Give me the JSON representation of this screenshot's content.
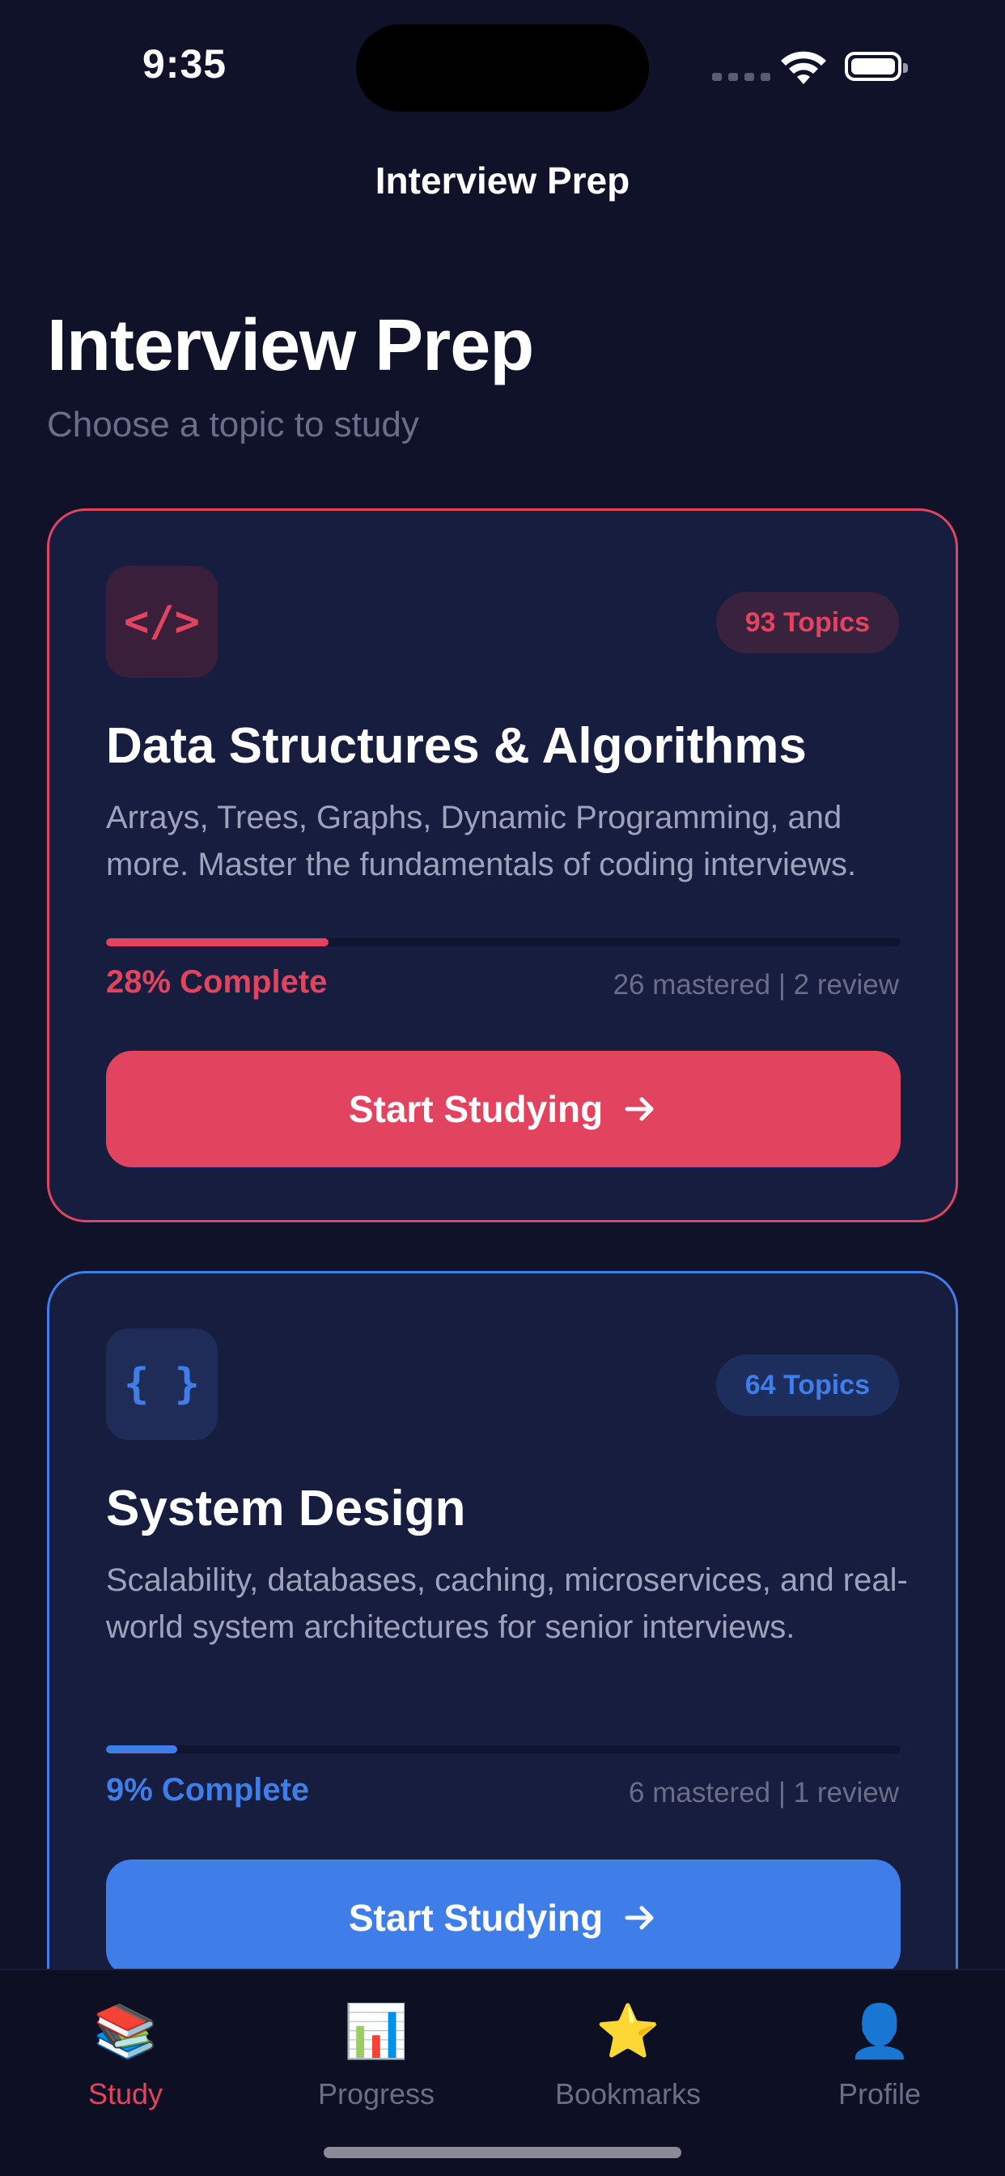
{
  "status": {
    "time": "9:35"
  },
  "nav": {
    "title": "Interview Prep"
  },
  "header": {
    "title": "Interview Prep",
    "subtitle": "Choose a topic to study"
  },
  "cards": [
    {
      "icon": "</>",
      "icon_name": "code-icon",
      "badge": "93 Topics",
      "title": "Data Structures & Algorithms",
      "description": "Arrays, Trees, Graphs, Dynamic Programming, and more. Master the fundamentals of coding interviews.",
      "progress_percent": 28,
      "progress_label": "28% Complete",
      "stats": "26 mastered | 2 review",
      "button_label": "Start Studying",
      "accent": "#e2445f"
    },
    {
      "icon": "{ }",
      "icon_name": "braces-icon",
      "badge": "64 Topics",
      "title": "System Design",
      "description": "Scalability, databases, caching, microservices, and real-world system architectures for senior interviews.",
      "progress_percent": 9,
      "progress_label": "9% Complete",
      "stats": "6 mastered | 1 review",
      "button_label": "Start Studying",
      "accent": "#3f7ee8"
    }
  ],
  "tabs": [
    {
      "label": "Study",
      "icon": "📚",
      "icon_name": "books-icon",
      "active": true
    },
    {
      "label": "Progress",
      "icon": "📊",
      "icon_name": "bar-chart-icon",
      "active": false
    },
    {
      "label": "Bookmarks",
      "icon": "⭐",
      "icon_name": "star-icon",
      "active": false
    },
    {
      "label": "Profile",
      "icon": "👤",
      "icon_name": "person-icon",
      "active": false
    }
  ],
  "colors": {
    "background": "#10122a",
    "card": "#161d3e",
    "red": "#e2445f",
    "blue": "#3f7ee8"
  }
}
